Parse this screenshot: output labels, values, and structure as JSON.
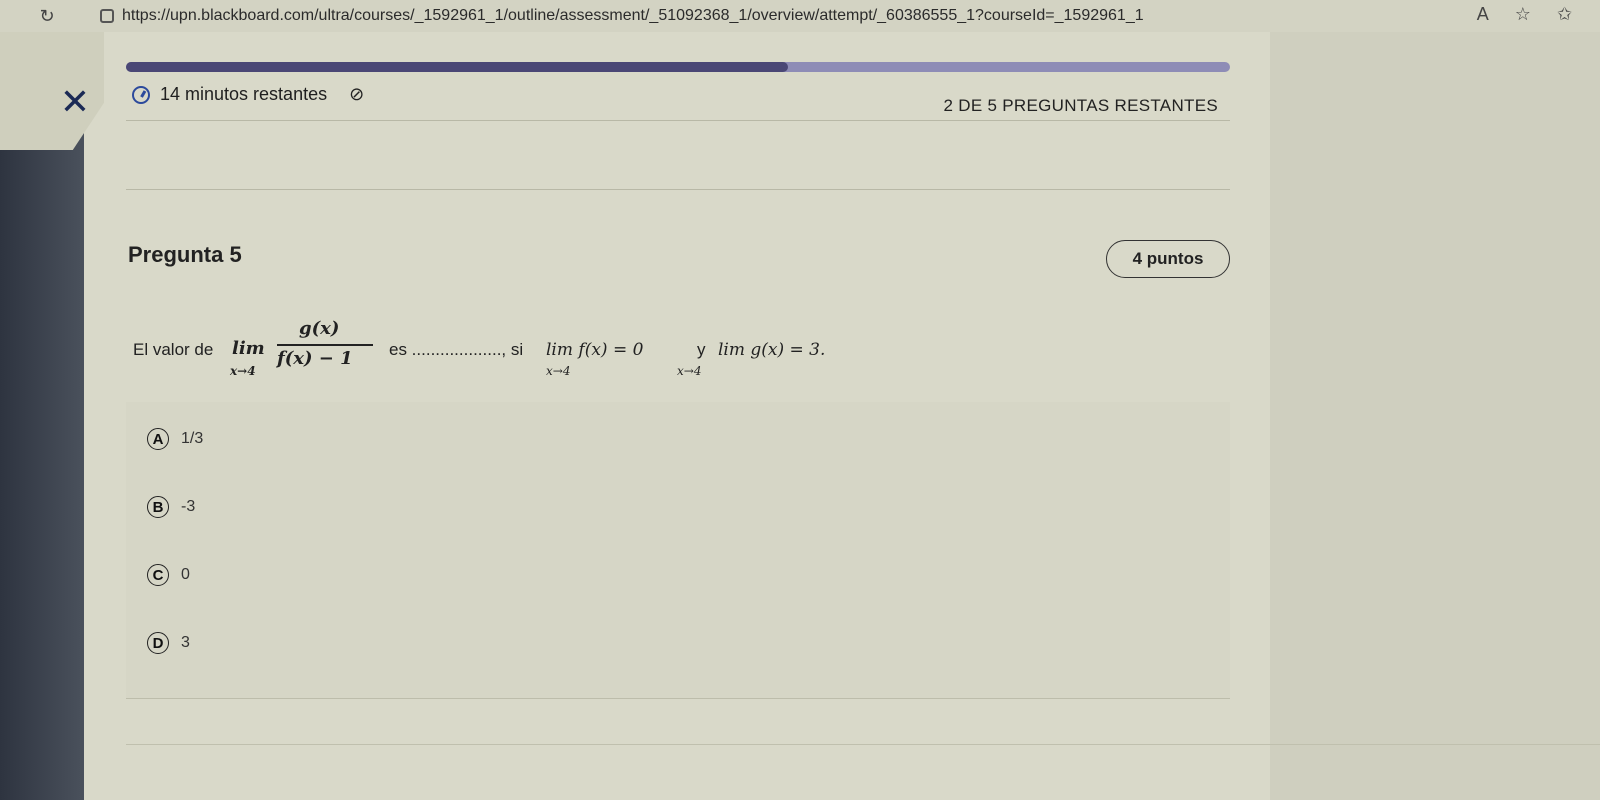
{
  "browser": {
    "url": "https://upn.blackboard.com/ultra/courses/_1592961_1/outline/assessment/_51092368_1/overview/attempt/_60386555_1?courseId=_1592961_1"
  },
  "header": {
    "timer_text": "14 minutos restantes",
    "remaining_text": "2 DE 5 PREGUNTAS RESTANTES",
    "progress": 0.6
  },
  "question": {
    "title": "Pregunta 5",
    "points": "4 puntos",
    "prefix": "El valor de",
    "lim": "lim",
    "lim_sub": "x→4",
    "numerator": "g(x)",
    "denominator": "f(x) − 1",
    "mid": "es ..................., si",
    "cond1": "lim f(x) = 0",
    "cond1_sub": "x→4",
    "conj": "y",
    "cond2": "lim g(x) = 3.",
    "cond2_sub": "x→4"
  },
  "answers": [
    {
      "letter": "A",
      "text": "1/3"
    },
    {
      "letter": "B",
      "text": "-3"
    },
    {
      "letter": "C",
      "text": "0"
    },
    {
      "letter": "D",
      "text": "3"
    }
  ],
  "colors": {
    "progress_fill": "#4a4775",
    "progress_track": "#8e8cb6",
    "close_icon": "#1b2a55"
  }
}
